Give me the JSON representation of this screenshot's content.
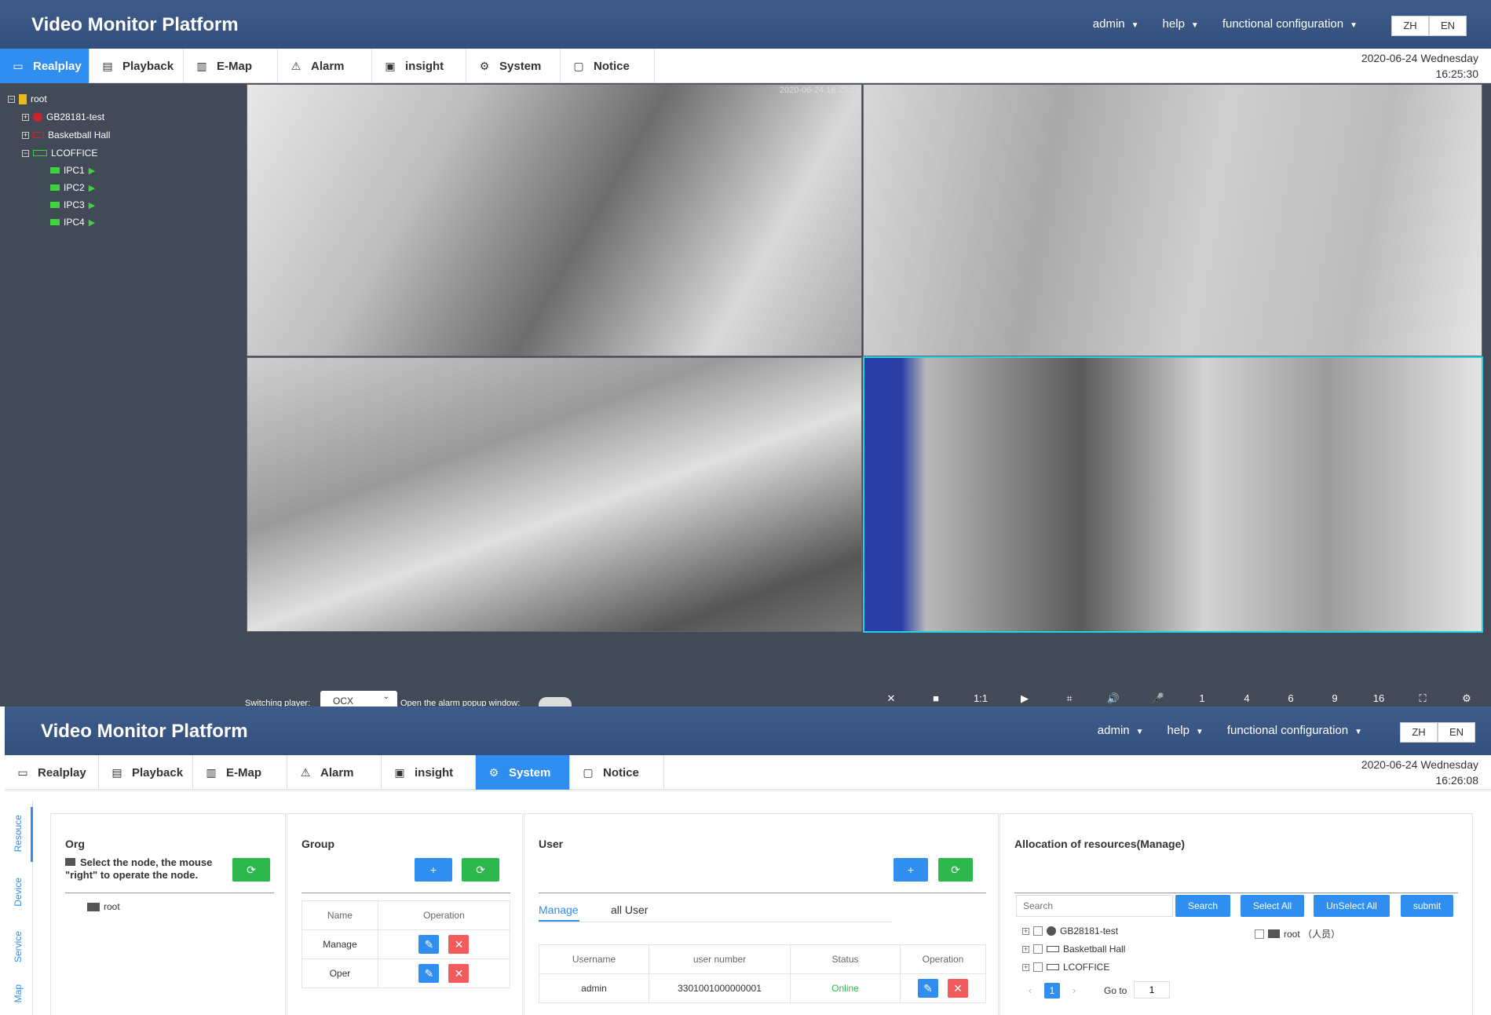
{
  "top": {
    "app_title": "Video Monitor Platform",
    "menu": {
      "user": "admin",
      "help": "help",
      "config": "functional configuration"
    },
    "lang": {
      "zh": "ZH",
      "en": "EN"
    },
    "tabs": [
      {
        "label": "Realplay",
        "icon": "camera-icon"
      },
      {
        "label": "Playback",
        "icon": "film-icon"
      },
      {
        "label": "E-Map",
        "icon": "map-icon"
      },
      {
        "label": "Alarm",
        "icon": "warning-icon"
      },
      {
        "label": "insight",
        "icon": "monitor-icon"
      },
      {
        "label": "System",
        "icon": "gear-icon"
      },
      {
        "label": "Notice",
        "icon": "message-icon"
      }
    ],
    "date": "2020-06-24 Wednesday",
    "time": "16:25:30",
    "tree": {
      "root": "root",
      "n1": "GB28181-test",
      "n2": "Basketball Hall",
      "n3": "LCOFFICE",
      "ipc1": "IPC1",
      "ipc2": "IPC2",
      "ipc3": "IPC3",
      "ipc4": "IPC4"
    },
    "video_timestamp": "2020-06-24 16:25:23",
    "player_label": "Switching player:",
    "player_value": "OCX",
    "alarm_popup_label": "Open the alarm popup window:",
    "controls": [
      "✕",
      "■",
      "1:1",
      "▶",
      "⌗",
      "🔊",
      "🎤",
      "1",
      "4",
      "6",
      "9",
      "16",
      "⛶",
      "⚙"
    ]
  },
  "bottom": {
    "app_title": "Video Monitor Platform",
    "menu": {
      "user": "admin",
      "help": "help",
      "config": "functional configuration"
    },
    "lang": {
      "zh": "ZH",
      "en": "EN"
    },
    "date": "2020-06-24 Wednesday",
    "time": "16:26:08",
    "side_tabs": [
      "Resouce",
      "Device",
      "Service",
      "Map"
    ],
    "org": {
      "title": "Org",
      "hint": "Select the node, the mouse \"right\" to operate the node.",
      "root": "root"
    },
    "group": {
      "title": "Group",
      "add": "+",
      "headers": [
        "Name",
        "Operation"
      ],
      "rows": [
        "Manage",
        "Oper"
      ]
    },
    "user": {
      "title": "User",
      "add": "+",
      "tabs": [
        "Manage",
        "all User"
      ],
      "headers": [
        "Username",
        "user number",
        "Status",
        "Operation"
      ],
      "rows": [
        {
          "username": "admin",
          "number": "3301001000000001",
          "status": "Online"
        }
      ]
    },
    "alloc": {
      "title": "Allocation of resources(Manage)",
      "search_placeholder": "Search",
      "search_btn": "Search",
      "select_all": "Select All",
      "unselect_all": "UnSelect All",
      "submit": "submit",
      "tree": [
        "GB28181-test",
        "Basketball Hall",
        "LCOFFICE"
      ],
      "right_root": "root （人员）",
      "page": "1",
      "goto_label": "Go to",
      "goto_value": "1"
    }
  },
  "colors": {
    "header": "#3e5c8b",
    "active_tab": "#2f8ef0",
    "sidebar": "#424a58",
    "green": "#2db84d",
    "red": "#f25b5b",
    "online": "#2db84d"
  }
}
